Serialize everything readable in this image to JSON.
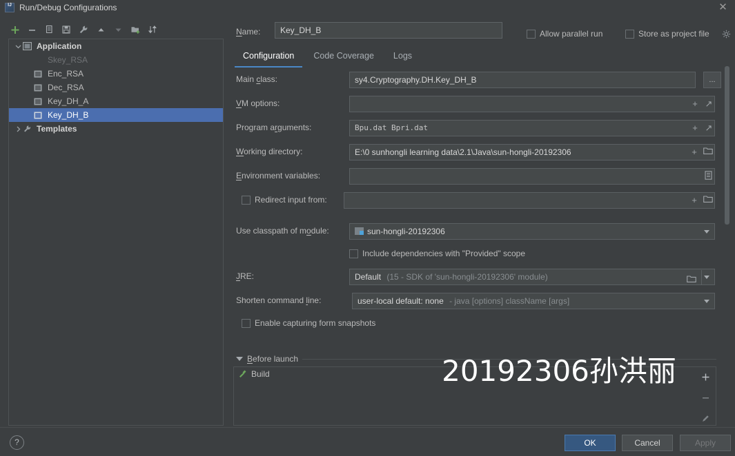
{
  "window": {
    "title": "Run/Debug Configurations",
    "app_icon": "intellij-idea-icon",
    "close_icon": "close-icon"
  },
  "left_toolbar": {
    "buttons": [
      {
        "name": "add-configuration-button",
        "icon": "plus-icon",
        "label": "+"
      },
      {
        "name": "remove-configuration-button",
        "icon": "minus-icon",
        "label": "−"
      },
      {
        "name": "copy-configuration-button",
        "icon": "copy-icon",
        "label": "Copy"
      },
      {
        "name": "save-configuration-button",
        "icon": "save-icon",
        "label": "Save"
      },
      {
        "name": "edit-templates-button",
        "icon": "wrench-icon",
        "label": "Edit Templates"
      },
      {
        "name": "move-up-button",
        "icon": "arrow-up-icon",
        "label": "Move Up"
      },
      {
        "name": "move-down-button",
        "icon": "arrow-down-icon",
        "label": "Move Down"
      },
      {
        "name": "move-into-folder-button",
        "icon": "folder-add-icon",
        "label": "New Folder"
      },
      {
        "name": "sort-configurations-button",
        "icon": "sort-icon",
        "label": "Sort"
      }
    ]
  },
  "tree": {
    "nodes": [
      {
        "label": "Application",
        "type": "group",
        "expanded": true,
        "icon": "application-icon",
        "selected": false,
        "dim": false
      },
      {
        "label": "Skey_RSA",
        "type": "leaf",
        "icon": "run-config-icon",
        "selected": false,
        "dim": true
      },
      {
        "label": "Enc_RSA",
        "type": "leaf",
        "icon": "run-config-icon",
        "selected": false,
        "dim": false
      },
      {
        "label": "Dec_RSA",
        "type": "leaf",
        "icon": "run-config-icon",
        "selected": false,
        "dim": false
      },
      {
        "label": "Key_DH_A",
        "type": "leaf",
        "icon": "run-config-icon",
        "selected": false,
        "dim": false
      },
      {
        "label": "Key_DH_B",
        "type": "leaf",
        "icon": "run-config-icon",
        "selected": true,
        "dim": false
      },
      {
        "label": "Templates",
        "type": "group",
        "expanded": false,
        "icon": "wrench-icon",
        "selected": false,
        "dim": false
      }
    ]
  },
  "header": {
    "name_label": "Name:",
    "name_value": "Key_DH_B",
    "allow_parallel_run": {
      "label": "Allow parallel run",
      "checked": false
    },
    "store_as_project_file": {
      "label": "Store as project file",
      "checked": false
    },
    "settings_icon": "gear-icon"
  },
  "tabs": [
    {
      "label": "Configuration",
      "active": true
    },
    {
      "label": "Code Coverage",
      "active": false
    },
    {
      "label": "Logs",
      "active": false
    }
  ],
  "form": {
    "main_class": {
      "label": "Main class:",
      "value": "sy4.Cryptography.DH.Key_DH_B",
      "browse_label": "..."
    },
    "vm_options": {
      "label": "VM options:",
      "value": "",
      "macro_icon": "plus-icon",
      "expand_icon": "expand-icon"
    },
    "program_arguments": {
      "label": "Program arguments:",
      "value": "Bpu.dat Bpri.dat",
      "macro_icon": "plus-icon",
      "expand_icon": "expand-icon"
    },
    "working_directory": {
      "label": "Working directory:",
      "value": "E:\\0 sunhongli learning data\\2.1\\Java\\sun-hongli-20192306",
      "macro_icon": "plus-icon",
      "browse_icon": "folder-icon"
    },
    "environment_variables": {
      "label": "Environment variables:",
      "value": "",
      "browse_icon": "list-icon"
    },
    "redirect_input": {
      "label": "Redirect input from:",
      "checked": false,
      "value": "",
      "macro_icon": "plus-icon",
      "browse_icon": "folder-icon"
    },
    "use_classpath_of_module": {
      "label": "Use classpath of module:",
      "value": "sun-hongli-20192306",
      "module_icon": "module-icon"
    },
    "include_provided_scope": {
      "label": "Include dependencies with \"Provided\" scope",
      "checked": false
    },
    "jre": {
      "label": "JRE:",
      "value": "Default",
      "hint": "(15 - SDK of 'sun-hongli-20192306' module)",
      "browse_icon": "folder-icon"
    },
    "shorten_command_line": {
      "label": "Shorten command line:",
      "value": "user-local default: none",
      "hint": "- java [options] className [args]"
    },
    "enable_capturing_form_snapshots": {
      "label": "Enable capturing form snapshots",
      "checked": false
    }
  },
  "before_launch": {
    "title": "Before launch",
    "expanded": true,
    "items": [
      {
        "label": "Build",
        "icon": "build-hammer-icon"
      }
    ],
    "tools": [
      {
        "name": "add-task-button",
        "icon": "plus-icon"
      },
      {
        "name": "remove-task-button",
        "icon": "minus-icon"
      },
      {
        "name": "edit-task-button",
        "icon": "pencil-icon"
      }
    ]
  },
  "watermark": {
    "text": "20192306孙洪丽"
  },
  "footer": {
    "help_label": "?",
    "ok_label": "OK",
    "cancel_label": "Cancel",
    "apply_label": "Apply"
  },
  "colors": {
    "background": "#3c3f41",
    "field_background": "#45494a",
    "selection_blue": "#4b6eaf",
    "tab_accent": "#4a88c7",
    "primary_button": "#365880"
  }
}
